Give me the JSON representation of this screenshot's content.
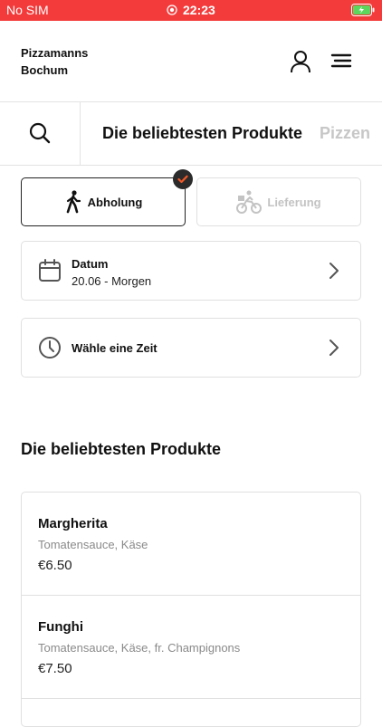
{
  "status_bar": {
    "carrier": "No SIM",
    "time": "22:23"
  },
  "header": {
    "store_line1": "Pizzamanns",
    "store_line2": "Bochum"
  },
  "tabs": [
    {
      "label": "Die beliebtesten Produkte",
      "active": true
    },
    {
      "label": "Pizzen",
      "active": false
    }
  ],
  "order_mode": {
    "pickup_label": "Abholung",
    "delivery_label": "Lieferung",
    "selected": "pickup"
  },
  "date_card": {
    "title": "Datum",
    "value": "20.06 - Morgen"
  },
  "time_card": {
    "title": "Wähle eine Zeit"
  },
  "section": {
    "title": "Die beliebtesten Produkte"
  },
  "products": [
    {
      "name": "Margherita",
      "description": "Tomatensauce, Käse",
      "price": "€6.50"
    },
    {
      "name": "Funghi",
      "description": "Tomatensauce, Käse, fr. Champignons",
      "price": "€7.50"
    }
  ],
  "colors": {
    "accent": "#f33b3b",
    "check_mark": "#f05a28"
  }
}
